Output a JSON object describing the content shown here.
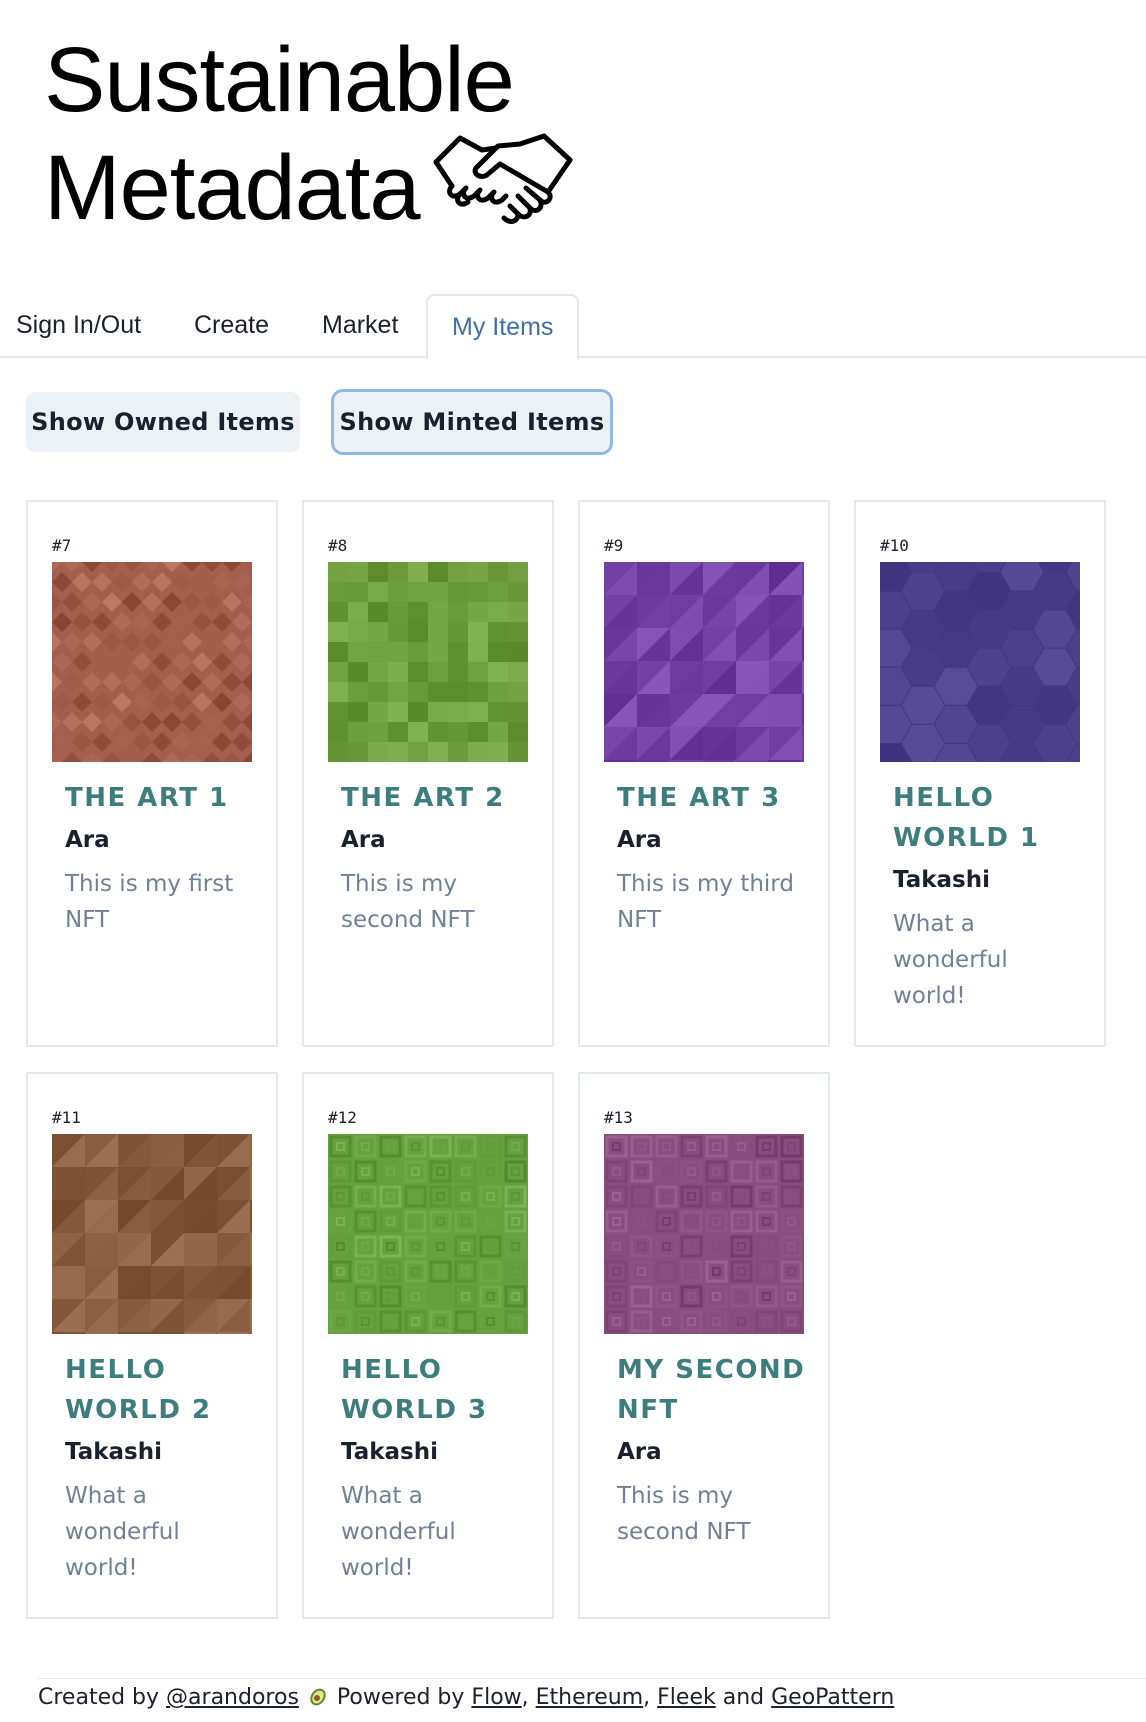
{
  "logo": {
    "line1": "Sustainable",
    "line2": "Metadata",
    "icon": "handshake-icon"
  },
  "tabs": [
    {
      "label": "Sign In/Out",
      "active": false
    },
    {
      "label": "Create",
      "active": false
    },
    {
      "label": "Market",
      "active": false
    },
    {
      "label": "My Items",
      "active": true
    }
  ],
  "buttons": {
    "owned": "Show Owned Items",
    "minted": "Show Minted Items"
  },
  "items": [
    {
      "id": "#7",
      "title": "THE ART 1",
      "author": "Ara",
      "description": "This is my first NFT",
      "pattern": "diamonds",
      "color": "#a35f4c"
    },
    {
      "id": "#8",
      "title": "THE ART 2",
      "author": "Ara",
      "description": "This is my second NFT",
      "pattern": "squares",
      "color": "#6f9e3e"
    },
    {
      "id": "#9",
      "title": "THE ART 3",
      "author": "Ara",
      "description": "This is my third NFT",
      "pattern": "triangles",
      "color": "#7442a5"
    },
    {
      "id": "#10",
      "title": "HELLO WORLD 1",
      "author": "Takashi",
      "description": "What a wonderful world!",
      "pattern": "hexagons",
      "color": "#4b3f8c"
    },
    {
      "id": "#11",
      "title": "HELLO WORLD 2",
      "author": "Takashi",
      "description": "What a wonderful world!",
      "pattern": "triangles",
      "color": "#8a5c3f"
    },
    {
      "id": "#12",
      "title": "HELLO WORLD 3",
      "author": "Takashi",
      "description": "What a wonderful world!",
      "pattern": "concentric-squares",
      "color": "#67a03e"
    },
    {
      "id": "#13",
      "title": "MY SECOND NFT",
      "author": "Ara",
      "description": "This is my second NFT",
      "pattern": "concentric-squares",
      "color": "#8a4d80"
    }
  ],
  "footer": {
    "created_by": "Created by",
    "author_link": "@arandoros",
    "powered_by": "Powered by",
    "link1": "Flow",
    "sep1": ",",
    "link2": "Ethereum",
    "sep2": ",",
    "link3": "Fleek",
    "and": "and",
    "link4": "GeoPattern",
    "emoji_icon": "avocado-icon"
  }
}
